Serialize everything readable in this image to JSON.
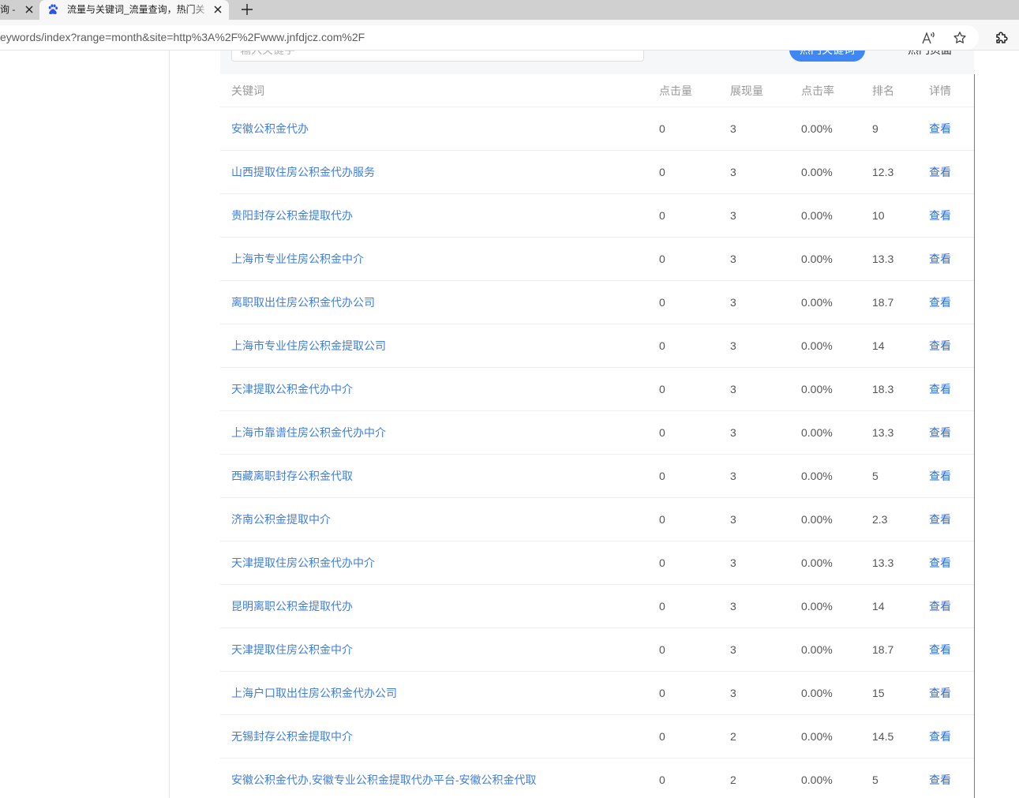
{
  "browser": {
    "tabs": [
      {
        "title": "询 -",
        "close_icon": "close-icon"
      },
      {
        "title": "流量与关键词_流量查询，热门关",
        "favicon": "baidu-paw-icon",
        "close_icon": "close-icon",
        "active": true
      }
    ],
    "new_tab_icon": "plus-icon",
    "address": "eywords/index?range=month&site=http%3A%2F%2Fwww.jnfdjcz.com%2F",
    "toolbar_icons": [
      "read-aloud-icon",
      "favorite-star-icon",
      "extensions-icon"
    ]
  },
  "search": {
    "placeholder": "输入关键字"
  },
  "view_tabs": {
    "hot_keywords": "热门关键词",
    "hot_pages": "热门页面"
  },
  "table": {
    "columns": [
      "关键词",
      "点击量",
      "展现量",
      "点击率",
      "排名",
      "详情"
    ],
    "rows": [
      {
        "keyword": "安徽公积金代办",
        "clicks": 0,
        "impressions": 3,
        "ctr": "0.00%",
        "rank": 9,
        "detail": "查看"
      },
      {
        "keyword": "山西提取住房公积金代办服务",
        "clicks": 0,
        "impressions": 3,
        "ctr": "0.00%",
        "rank": 12.3,
        "detail": "查看"
      },
      {
        "keyword": "贵阳封存公积金提取代办",
        "clicks": 0,
        "impressions": 3,
        "ctr": "0.00%",
        "rank": 10,
        "detail": "查看"
      },
      {
        "keyword": "上海市专业住房公积金中介",
        "clicks": 0,
        "impressions": 3,
        "ctr": "0.00%",
        "rank": 13.3,
        "detail": "查看"
      },
      {
        "keyword": "离职取出住房公积金代办公司",
        "clicks": 0,
        "impressions": 3,
        "ctr": "0.00%",
        "rank": 18.7,
        "detail": "查看"
      },
      {
        "keyword": "上海市专业住房公积金提取公司",
        "clicks": 0,
        "impressions": 3,
        "ctr": "0.00%",
        "rank": 14,
        "detail": "查看"
      },
      {
        "keyword": "天津提取公积金代办中介",
        "clicks": 0,
        "impressions": 3,
        "ctr": "0.00%",
        "rank": 18.3,
        "detail": "查看"
      },
      {
        "keyword": "上海市靠谱住房公积金代办中介",
        "clicks": 0,
        "impressions": 3,
        "ctr": "0.00%",
        "rank": 13.3,
        "detail": "查看"
      },
      {
        "keyword": "西藏离职封存公积金代取",
        "clicks": 0,
        "impressions": 3,
        "ctr": "0.00%",
        "rank": 5,
        "detail": "查看"
      },
      {
        "keyword": "济南公积金提取中介",
        "clicks": 0,
        "impressions": 3,
        "ctr": "0.00%",
        "rank": 2.3,
        "detail": "查看"
      },
      {
        "keyword": "天津提取住房公积金代办中介",
        "clicks": 0,
        "impressions": 3,
        "ctr": "0.00%",
        "rank": 13.3,
        "detail": "查看"
      },
      {
        "keyword": "昆明离职公积金提取代办",
        "clicks": 0,
        "impressions": 3,
        "ctr": "0.00%",
        "rank": 14,
        "detail": "查看"
      },
      {
        "keyword": "天津提取住房公积金中介",
        "clicks": 0,
        "impressions": 3,
        "ctr": "0.00%",
        "rank": 18.7,
        "detail": "查看"
      },
      {
        "keyword": "上海户口取出住房公积金代办公司",
        "clicks": 0,
        "impressions": 3,
        "ctr": "0.00%",
        "rank": 15,
        "detail": "查看"
      },
      {
        "keyword": "无锡封存公积金提取中介",
        "clicks": 0,
        "impressions": 2,
        "ctr": "0.00%",
        "rank": 14.5,
        "detail": "查看"
      },
      {
        "keyword": "安徽公积金代办,安徽专业公积金提取代办平台-安徽公积金代取",
        "clicks": 0,
        "impressions": 2,
        "ctr": "0.00%",
        "rank": 5,
        "detail": "查看"
      }
    ]
  },
  "colors": {
    "link": "#407edc",
    "detail_link": "#2c6dd6",
    "primary": "#3f87f5",
    "header_text": "#999999",
    "cell_text": "#555555"
  }
}
